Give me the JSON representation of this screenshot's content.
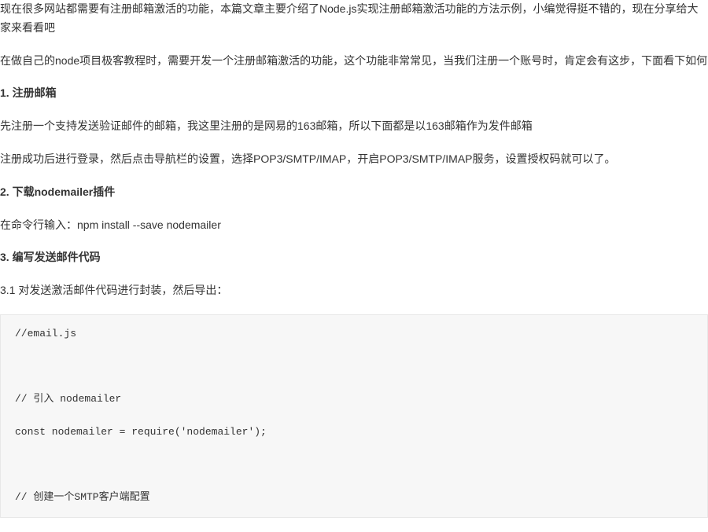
{
  "intro_p1": "现在很多网站都需要有注册邮箱激活的功能，本篇文章主要介绍了Node.js实现注册邮箱激活功能的方法示例，小编觉得挺不错的，现在分享给大家来看看吧",
  "intro_p2": "在做自己的node项目极客教程时，需要开发一个注册邮箱激活的功能，这个功能非常常见，当我们注册一个账号时，肯定会有这步，下面看下如何",
  "section1": {
    "heading": "1. 注册邮箱",
    "p1": "先注册一个支持发送验证邮件的邮箱，我这里注册的是网易的163邮箱，所以下面都是以163邮箱作为发件邮箱",
    "p2": "注册成功后进行登录，然后点击导航栏的设置，选择POP3/SMTP/IMAP，开启POP3/SMTP/IMAP服务，设置授权码就可以了。"
  },
  "section2": {
    "heading": "2. 下载nodemailer插件",
    "p1": "在命令行输入：npm install --save nodemailer"
  },
  "section3": {
    "heading": "3. 编写发送邮件代码",
    "sub1": "3.1 对发送激活邮件代码进行封装，然后导出：",
    "code1": "//email.js\n\n\n\n// 引入 nodemailer\n\nconst nodemailer = require('nodemailer');\n\n\n\n// 创建一个SMTP客户端配置"
  }
}
